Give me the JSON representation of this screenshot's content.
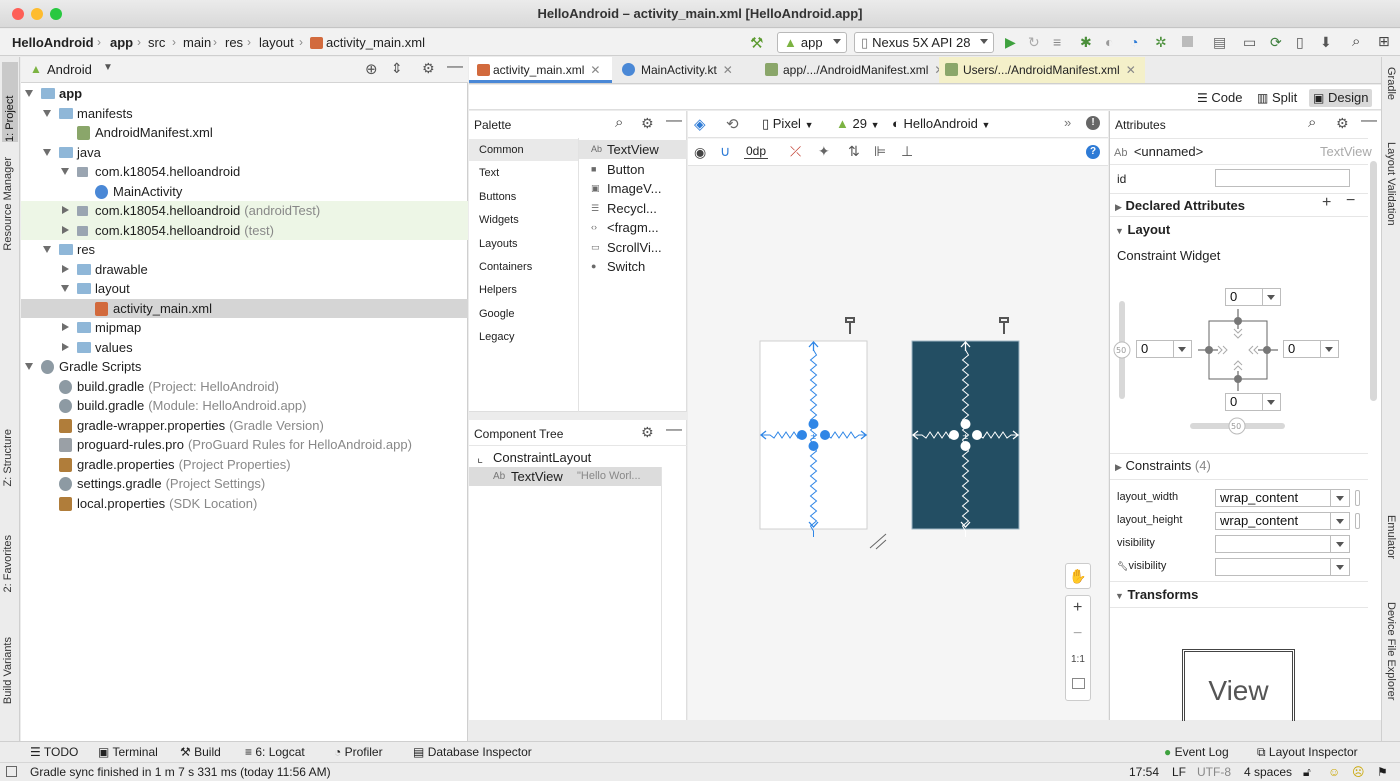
{
  "window": {
    "title": "HelloAndroid – activity_main.xml [HelloAndroid.app]"
  },
  "breadcrumb": [
    "HelloAndroid",
    "app",
    "src",
    "main",
    "res",
    "layout",
    "activity_main.xml"
  ],
  "toolbar": {
    "run_config": "app",
    "device": "Nexus 5X API 28"
  },
  "left_tabs": [
    "1: Project",
    "Resource Manager",
    "Z: Structure",
    "2: Favorites",
    "Build Variants"
  ],
  "right_tabs": [
    "Gradle",
    "Layout Validation",
    "Emulator",
    "Device File Explorer"
  ],
  "project": {
    "view_mode": "Android",
    "tree": [
      {
        "label": "app",
        "extra": "",
        "depth": 0,
        "expanded": true,
        "icon": "folder-icon",
        "bold": true
      },
      {
        "label": "manifests",
        "extra": "",
        "depth": 1,
        "expanded": true,
        "icon": "folder-icon"
      },
      {
        "label": "AndroidManifest.xml",
        "extra": "",
        "depth": 2,
        "icon": "manifest-file-icon"
      },
      {
        "label": "java",
        "extra": "",
        "depth": 1,
        "expanded": true,
        "icon": "folder-icon"
      },
      {
        "label": "com.k18054.helloandroid",
        "extra": "",
        "depth": 2,
        "expanded": true,
        "icon": "package-icon"
      },
      {
        "label": "MainActivity",
        "extra": "",
        "depth": 3,
        "icon": "kotlin-class-icon"
      },
      {
        "label": "com.k18054.helloandroid",
        "extra": "(androidTest)",
        "depth": 2,
        "expanded": false,
        "icon": "package-icon",
        "highlight": true
      },
      {
        "label": "com.k18054.helloandroid",
        "extra": "(test)",
        "depth": 2,
        "expanded": false,
        "icon": "package-icon",
        "highlight": true
      },
      {
        "label": "res",
        "extra": "",
        "depth": 1,
        "expanded": true,
        "icon": "folder-icon"
      },
      {
        "label": "drawable",
        "extra": "",
        "depth": 2,
        "expanded": false,
        "icon": "folder-icon"
      },
      {
        "label": "layout",
        "extra": "",
        "depth": 2,
        "expanded": true,
        "icon": "folder-icon"
      },
      {
        "label": "activity_main.xml",
        "extra": "",
        "depth": 3,
        "icon": "layout-file-icon",
        "selected": true
      },
      {
        "label": "mipmap",
        "extra": "",
        "depth": 2,
        "expanded": false,
        "icon": "folder-icon"
      },
      {
        "label": "values",
        "extra": "",
        "depth": 2,
        "expanded": false,
        "icon": "folder-icon"
      },
      {
        "label": "Gradle Scripts",
        "extra": "",
        "depth": 0,
        "expanded": true,
        "icon": "gradle-icon"
      },
      {
        "label": "build.gradle",
        "extra": "(Project: HelloAndroid)",
        "depth": 1,
        "icon": "gradle-icon"
      },
      {
        "label": "build.gradle",
        "extra": "(Module: HelloAndroid.app)",
        "depth": 1,
        "icon": "gradle-icon"
      },
      {
        "label": "gradle-wrapper.properties",
        "extra": "(Gradle Version)",
        "depth": 1,
        "icon": "properties-icon"
      },
      {
        "label": "proguard-rules.pro",
        "extra": "(ProGuard Rules for HelloAndroid.app)",
        "depth": 1,
        "icon": "text-file-icon"
      },
      {
        "label": "gradle.properties",
        "extra": "(Project Properties)",
        "depth": 1,
        "icon": "properties-icon"
      },
      {
        "label": "settings.gradle",
        "extra": "(Project Settings)",
        "depth": 1,
        "icon": "gradle-icon"
      },
      {
        "label": "local.properties",
        "extra": "(SDK Location)",
        "depth": 1,
        "icon": "properties-icon"
      }
    ]
  },
  "editor_tabs": [
    {
      "label": "activity_main.xml",
      "active": true,
      "icon": "layout-file-icon"
    },
    {
      "label": "MainActivity.kt",
      "active": false,
      "icon": "kotlin-class-icon"
    },
    {
      "label": "app/.../AndroidManifest.xml",
      "active": false,
      "icon": "manifest-file-icon"
    },
    {
      "label": "Users/.../AndroidManifest.xml",
      "active": false,
      "icon": "manifest-file-icon",
      "highlight": true
    }
  ],
  "modes": {
    "code": "Code",
    "split": "Split",
    "design": "Design"
  },
  "palette": {
    "title": "Palette",
    "categories": [
      "Common",
      "Text",
      "Buttons",
      "Widgets",
      "Layouts",
      "Containers",
      "Helpers",
      "Google",
      "Legacy"
    ],
    "items": [
      {
        "label": "TextView",
        "icon": "Ab"
      },
      {
        "label": "Button",
        "icon": "■"
      },
      {
        "label": "ImageV...",
        "icon": "▣"
      },
      {
        "label": "Recycl...",
        "icon": "☰"
      },
      {
        "label": "<fragm...",
        "icon": "‹›"
      },
      {
        "label": "ScrollVi...",
        "icon": "▭"
      },
      {
        "label": "Switch",
        "icon": "●"
      }
    ]
  },
  "component_tree": {
    "title": "Component Tree",
    "root": "ConstraintLayout",
    "child": "TextView",
    "child_text": "\"Hello Worl..."
  },
  "design_toolbar": {
    "device": "Pixel",
    "api": "29",
    "theme": "HelloAndroid",
    "margin": "0dp"
  },
  "attributes": {
    "title": "Attributes",
    "widget_type": "Ab",
    "widget_name": "<unnamed>",
    "widget_class": "TextView",
    "id_label": "id",
    "id_value": "",
    "declared": "Declared Attributes",
    "layout": "Layout",
    "constraint_widget": "Constraint Widget",
    "margins": {
      "top": "0",
      "left": "0",
      "right": "0",
      "bottom": "0"
    },
    "bias_v": "50",
    "bias_h": "50",
    "constraints_label": "Constraints",
    "constraints_count": "(4)",
    "rows": [
      {
        "label": "layout_width",
        "value": "wrap_content"
      },
      {
        "label": "layout_height",
        "value": "wrap_content"
      },
      {
        "label": "visibility",
        "value": ""
      },
      {
        "label": "visibility",
        "value": ""
      }
    ],
    "transforms": "Transforms",
    "view_preview": "View"
  },
  "bottom_tabs": [
    "TODO",
    "Terminal",
    "Build",
    "6: Logcat",
    "Profiler",
    "Database Inspector"
  ],
  "bottom_right_tabs": [
    "Event Log",
    "Layout Inspector"
  ],
  "status": {
    "message": "Gradle sync finished in 1 m 7 s 331 ms (today 11:56 AM)",
    "position": "17:54",
    "line_sep": "LF",
    "encoding": "UTF-8",
    "indent": "4 spaces"
  },
  "colors": {
    "accent": "#4a88d6",
    "blueprint": "#234e63",
    "constraint": "#2f86e6",
    "tree_highlight": "#edf6e6"
  }
}
